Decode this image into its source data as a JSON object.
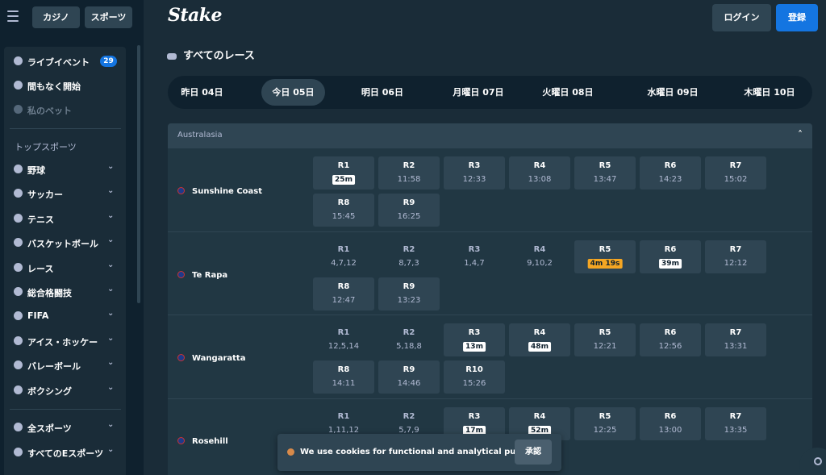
{
  "header": {
    "tab_casino": "カジノ",
    "tab_sports": "スポーツ",
    "logo": "Stake",
    "login": "ログイン",
    "register": "登録"
  },
  "sidebar": {
    "items": [
      {
        "label": "ライブイベント",
        "icon": "play-icon",
        "badge": "29"
      },
      {
        "label": "間もなく開始",
        "icon": "stopwatch-icon"
      },
      {
        "label": "私のベット",
        "icon": "ticket-icon"
      }
    ],
    "heading": "トップスポーツ",
    "sports": [
      {
        "label": "野球",
        "icon": "baseball-icon"
      },
      {
        "label": "サッカー",
        "icon": "soccer-icon"
      },
      {
        "label": "テニス",
        "icon": "tennis-icon"
      },
      {
        "label": "バスケットボール",
        "icon": "basketball-icon"
      },
      {
        "label": "レース",
        "icon": "horse-icon"
      },
      {
        "label": "総合格闘技",
        "icon": "mma-icon"
      },
      {
        "label": "FIFA",
        "icon": "fifa-icon"
      },
      {
        "label": "アイス・ホッケー",
        "icon": "hockey-icon"
      },
      {
        "label": "バレーボール",
        "icon": "volleyball-icon"
      },
      {
        "label": "ボクシング",
        "icon": "boxing-glove-icon"
      }
    ],
    "more": [
      {
        "label": "全スポーツ",
        "icon": "all-sports-icon"
      },
      {
        "label": "すべてのEスポーツ",
        "icon": "gamepad-icon"
      }
    ]
  },
  "main": {
    "title": "すべてのレース",
    "date_tabs": [
      {
        "label": "昨日 04日",
        "active": false
      },
      {
        "label": "今日 05日",
        "active": true
      },
      {
        "label": "明日 06日",
        "active": false
      },
      {
        "label": "月曜日 07日",
        "active": false
      },
      {
        "label": "火曜日 08日",
        "active": false
      },
      {
        "label": "水曜日 09日",
        "active": false
      },
      {
        "label": "木曜日 10日",
        "active": false
      }
    ],
    "region": "Australasia",
    "tracks": [
      {
        "name": "Sunshine Coast",
        "races": [
          {
            "r": "R1",
            "v": "25m",
            "kind": "pill"
          },
          {
            "r": "R2",
            "v": "11:58",
            "kind": "box"
          },
          {
            "r": "R3",
            "v": "12:33",
            "kind": "box"
          },
          {
            "r": "R4",
            "v": "13:08",
            "kind": "box"
          },
          {
            "r": "R5",
            "v": "13:47",
            "kind": "box"
          },
          {
            "r": "R6",
            "v": "14:23",
            "kind": "box"
          },
          {
            "r": "R7",
            "v": "15:02",
            "kind": "box"
          },
          {
            "r": "R8",
            "v": "15:45",
            "kind": "box"
          },
          {
            "r": "R9",
            "v": "16:25",
            "kind": "box"
          }
        ]
      },
      {
        "name": "Te Rapa",
        "races": [
          {
            "r": "R1",
            "v": "4,7,12",
            "kind": "plain"
          },
          {
            "r": "R2",
            "v": "8,7,3",
            "kind": "plain"
          },
          {
            "r": "R3",
            "v": "1,4,7",
            "kind": "plain"
          },
          {
            "r": "R4",
            "v": "9,10,2",
            "kind": "plain"
          },
          {
            "r": "R5",
            "v": "4m 19s",
            "kind": "warn"
          },
          {
            "r": "R6",
            "v": "39m",
            "kind": "pill"
          },
          {
            "r": "R7",
            "v": "12:12",
            "kind": "box"
          },
          {
            "r": "R8",
            "v": "12:47",
            "kind": "box"
          },
          {
            "r": "R9",
            "v": "13:23",
            "kind": "box"
          }
        ]
      },
      {
        "name": "Wangaratta",
        "races": [
          {
            "r": "R1",
            "v": "12,5,14",
            "kind": "plain"
          },
          {
            "r": "R2",
            "v": "5,18,8",
            "kind": "plain"
          },
          {
            "r": "R3",
            "v": "13m",
            "kind": "pill"
          },
          {
            "r": "R4",
            "v": "48m",
            "kind": "pill"
          },
          {
            "r": "R5",
            "v": "12:21",
            "kind": "box"
          },
          {
            "r": "R6",
            "v": "12:56",
            "kind": "box"
          },
          {
            "r": "R7",
            "v": "13:31",
            "kind": "box"
          },
          {
            "r": "R8",
            "v": "14:11",
            "kind": "box"
          },
          {
            "r": "R9",
            "v": "14:46",
            "kind": "box"
          },
          {
            "r": "R10",
            "v": "15:26",
            "kind": "box"
          }
        ]
      },
      {
        "name": "Rosehill",
        "races": [
          {
            "r": "R1",
            "v": "1,11,12",
            "kind": "plain"
          },
          {
            "r": "R2",
            "v": "5,7,9",
            "kind": "plain"
          },
          {
            "r": "R3",
            "v": "17m",
            "kind": "pill"
          },
          {
            "r": "R4",
            "v": "52m",
            "kind": "pill"
          },
          {
            "r": "R5",
            "v": "12:25",
            "kind": "box"
          },
          {
            "r": "R6",
            "v": "13:00",
            "kind": "box"
          },
          {
            "r": "R7",
            "v": "13:35",
            "kind": "box"
          }
        ]
      }
    ]
  },
  "cookie": {
    "text": "We use cookies for functional and analytical purpose.",
    "accept": "承認"
  },
  "colors": {
    "background": "#1a2c38",
    "sidebar": "#0f212e",
    "card": "#2f4553",
    "accent_blue": "#1475e1",
    "warning": "#f5a623"
  }
}
